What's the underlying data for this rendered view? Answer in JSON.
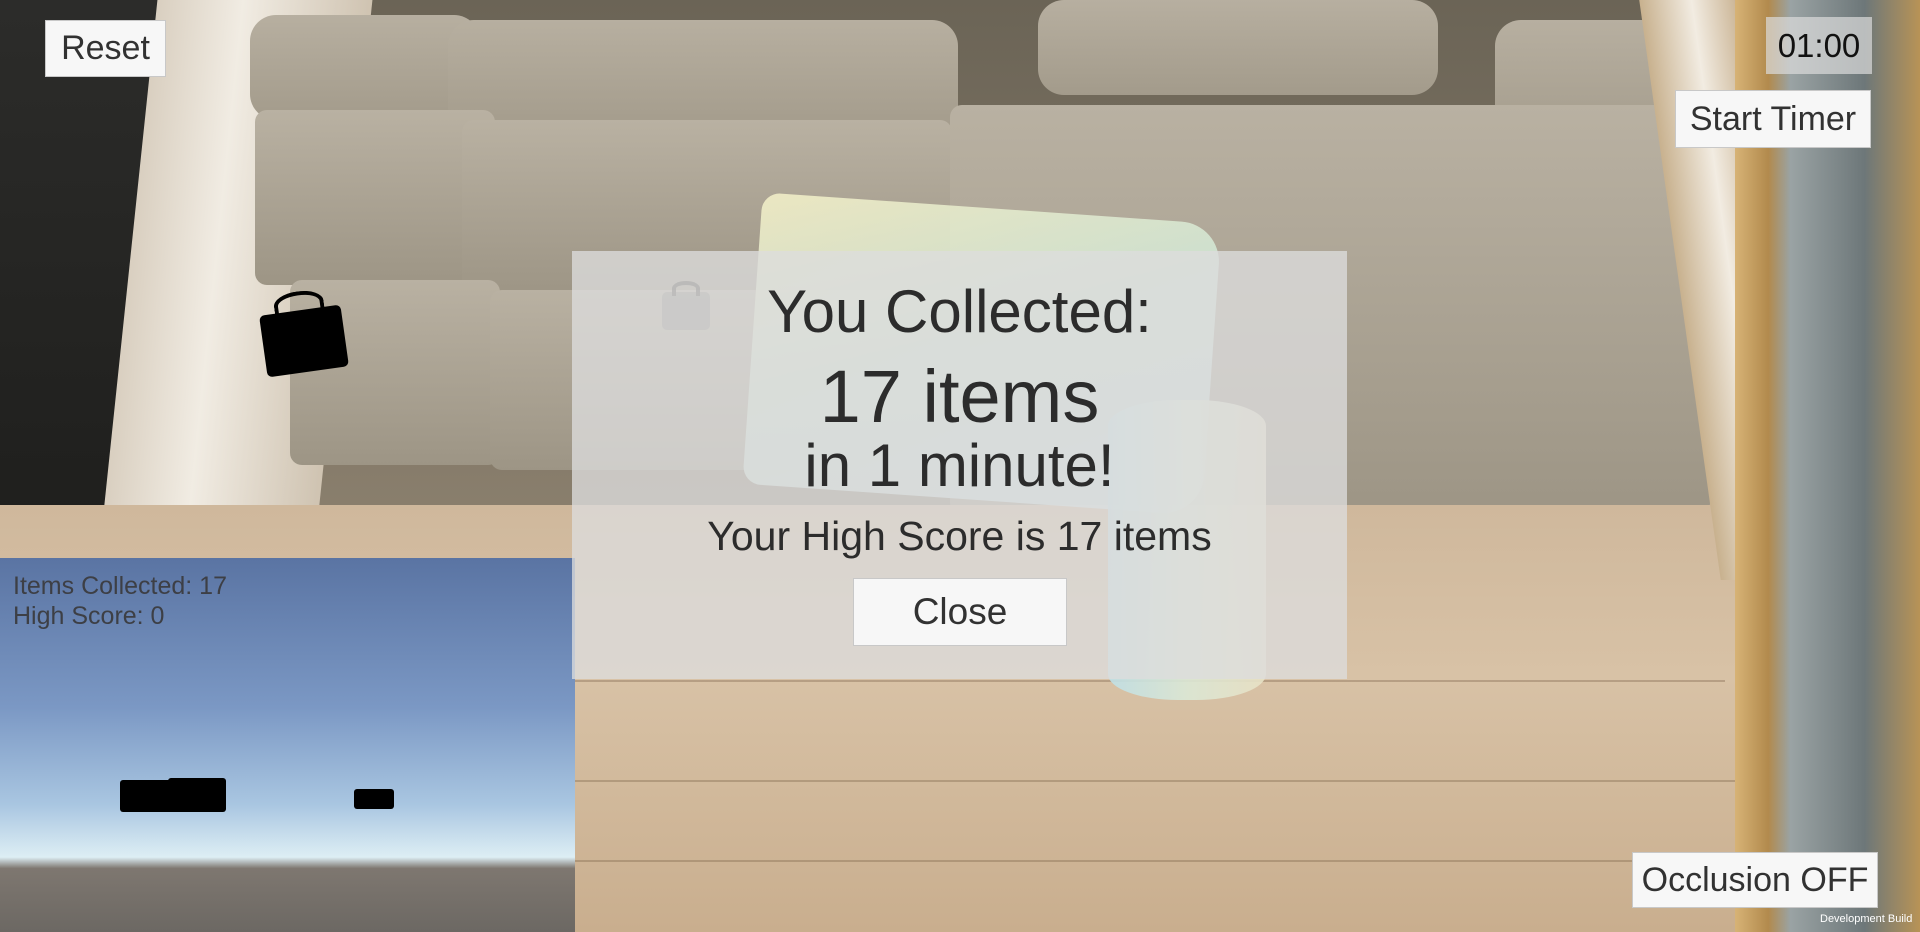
{
  "toolbar": {
    "reset_label": "Reset",
    "start_timer_label": "Start Timer",
    "occlusion_label": "Occlusion OFF",
    "timer_value": "01:00"
  },
  "minimap": {
    "items_collected": "Items Collected: 17",
    "high_score": "High Score: 0"
  },
  "result_dialog": {
    "title": "You Collected:",
    "count": "17 items",
    "duration": "in 1 minute!",
    "high_score": "Your High Score is 17 items",
    "close_label": "Close"
  },
  "footer": {
    "build_label": "Development Build"
  },
  "colors": {
    "panel": "#dcdcdc",
    "button_bg": "#f7f7f7",
    "text": "#2c2c2c"
  }
}
